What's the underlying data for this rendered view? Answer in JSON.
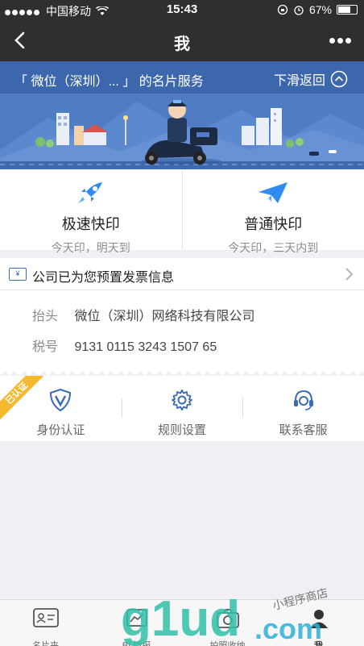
{
  "status_bar": {
    "carrier": "中国移动",
    "time": "15:43",
    "battery": "67%",
    "battery_level": 0.67
  },
  "nav": {
    "title": "我"
  },
  "banner": {
    "company": "「 微位（深圳）... 」",
    "service": "的名片服务",
    "swipe_back": "下滑返回"
  },
  "print_options": [
    {
      "name": "极速快印",
      "desc": "今天印，明天到",
      "icon": "rocket-icon"
    },
    {
      "name": "普通快印",
      "desc": "今天印，三天内到",
      "icon": "paper-plane-icon"
    }
  ],
  "invoice": {
    "icon_text": "¥",
    "heading": "公司已为您预置发票信息",
    "title_label": "抬头",
    "title_value": "微位（深圳）网络科技有限公司",
    "tax_label": "税号",
    "tax_value": "9131 0115 3243 1507 65"
  },
  "actions": {
    "badge": "已认证",
    "items": [
      {
        "label": "身份认证",
        "icon": "verified-shield-icon"
      },
      {
        "label": "规则设置",
        "icon": "gear-icon"
      },
      {
        "label": "联系客服",
        "icon": "headset-icon"
      }
    ]
  },
  "tabs": [
    {
      "label": "名片夹",
      "icon": "card-holder-icon"
    },
    {
      "label": "BI 情报",
      "icon": "bi-report-icon"
    },
    {
      "label": "拍照收纳",
      "icon": "camera-icon"
    },
    {
      "label": "我",
      "icon": "profile-icon",
      "active": true
    }
  ],
  "watermark": {
    "text": "g1ud",
    "suffix": ".com",
    "script": "小程序商店"
  },
  "colors": {
    "nav_bg": "#2f2f2f",
    "banner_blue": "#4f7cc2",
    "accent_blue": "#3b6bb6",
    "badge_gold": "#f5b82e"
  }
}
